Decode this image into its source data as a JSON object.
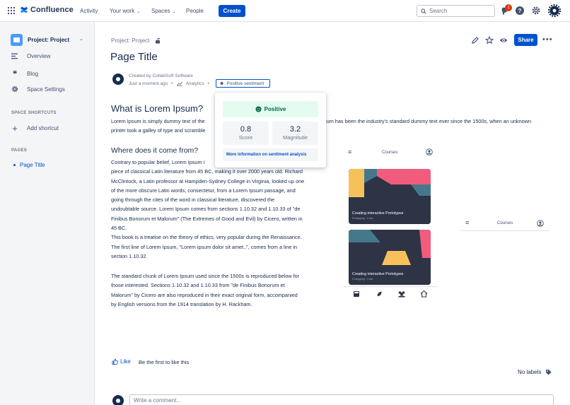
{
  "topbar": {
    "product": "Confluence",
    "nav": [
      "Activity",
      "Your work",
      "Spaces",
      "People"
    ],
    "create_label": "Create",
    "search_placeholder": "Search",
    "notification_count": "1"
  },
  "sidebar": {
    "project_name": "Project: Project",
    "items": [
      {
        "label": "Overview",
        "icon": "overview-icon"
      },
      {
        "label": "Blog",
        "icon": "quote-icon"
      },
      {
        "label": "Space Settings",
        "icon": "gear-icon"
      }
    ],
    "shortcuts_heading": "SPACE SHORTCUTS",
    "add_shortcut": "Add shortcut",
    "pages_heading": "PAGES",
    "pages": [
      "Page Title"
    ]
  },
  "page": {
    "breadcrumb": "Project: Project",
    "title": "Page Title",
    "share_label": "Share",
    "created_by": "Created by CollabSoft Software",
    "time": "Just a moment ago",
    "analytics": "Analytics",
    "sentiment_button": "Positive sentiment",
    "h2": "What is Lorem Ipsum?",
    "intro": [
      "Lorem Ipsum is simply dummy text of the",
      "sum has been the industry's standard dummy text ever since the 1500s, when an unknown",
      "printer took a galley of type and scramble"
    ],
    "h3": "Where does it come from?",
    "body_lines": [
      "Contrary to popular belief, Lorem Ipsum i",
      "piece of classical Latin literature from 45 BC, making it over 2000 years old. Richard",
      "McClintock, a Latin professor at Hampden-Sydney College in Virginia, looked up one",
      "of the more obscure Latin words, consectetur, from a Lorem Ipsum passage, and",
      "going through the cites of the word in classical literature, discovered the",
      "undoubtable source. Lorem Ipsum comes from sections 1.10.32 and 1.10.33 of \"de",
      "Finibus Bonorum et Malorum\" (The Extremes of Good and Evil) by Cicero, written in",
      "45 BC.",
      "This book is a treatise on the theory of ethics, very popular during the Renaissance.",
      "The first line of Lorem Ipsum, \"Lorem ipsum dolor sit amet..\", comes from a line in",
      "section 1.10.32."
    ],
    "body2_lines": [
      "The standard chunk of Lorem Ipsum used since the 1500s is reproduced below for",
      "those interested. Sections 1.10.32 and 1.10.33 from \"de Finibus Bonorum et",
      "Malorum\" by Cicero are also reproduced in their exact original form, accompanied",
      "by English versions from the 1914 translation by H. Rackham."
    ]
  },
  "sentiment_popup": {
    "label": "Positive",
    "score_value": "0.8",
    "score_label": "Score",
    "magnitude_value": "3.2",
    "magnitude_label": "Magnitude",
    "more_info": "More information on sentiment analysis"
  },
  "mockups": {
    "header_title": "Courses",
    "card_title": "Creating interactive Prototypes",
    "card_sub": "Prototyping · 3 min"
  },
  "footer": {
    "like": "Like",
    "first_to_like": "Be the first to like this",
    "no_labels": "No labels",
    "comment_placeholder": "Write a comment..."
  },
  "colors": {
    "brand_blue": "#0052cc",
    "positive_bg": "#e3fcef",
    "positive_text": "#006644",
    "mock_pink": "#f25c7c",
    "mock_yellow": "#f6c15b",
    "mock_teal": "#46788c"
  }
}
